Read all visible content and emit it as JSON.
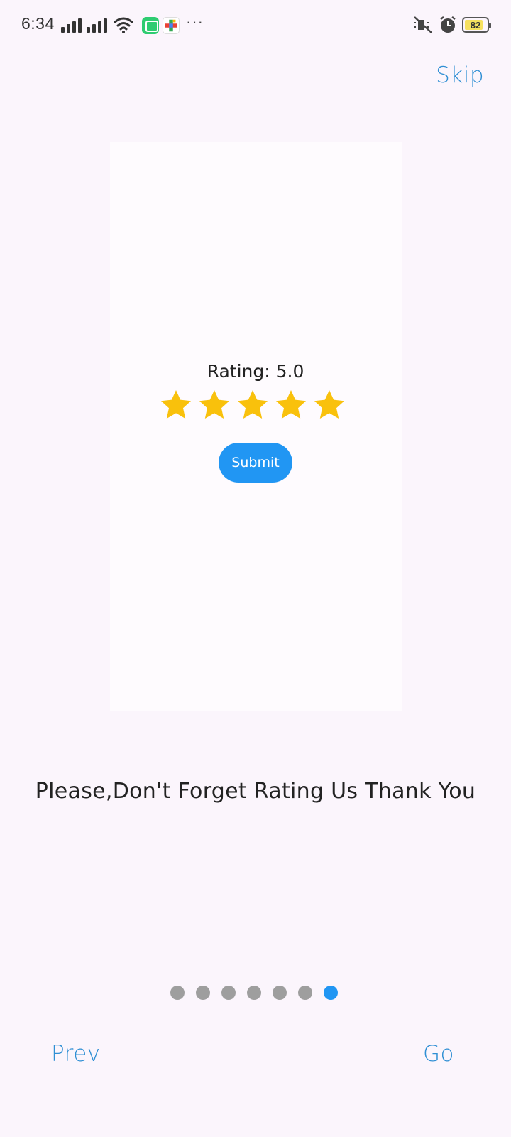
{
  "status_bar": {
    "time": "6:34",
    "battery_level": "82",
    "battery_fraction": 0.82,
    "icons": [
      "signal-icon",
      "signal-icon",
      "wifi-icon",
      "chat-app-icon",
      "app-icon",
      "more-icon",
      "mute-icon",
      "alarm-icon",
      "battery-icon"
    ]
  },
  "nav": {
    "skip_label": "Skip",
    "prev_label": "Prev",
    "go_label": "Go"
  },
  "rating_card": {
    "rating_text": "Rating: 5.0",
    "rating_value": 5.0,
    "max_stars": 5,
    "submit_label": "Submit"
  },
  "message": "Please,Don't Forget Rating Us Thank You",
  "pager": {
    "total_pages": 7,
    "current_page": 7
  },
  "colors": {
    "accent": "#2196f3",
    "link": "#2f8fd4",
    "star": "#f9c10c",
    "inactive_dot": "#9e9e9e",
    "background": "#fbf5fc"
  }
}
